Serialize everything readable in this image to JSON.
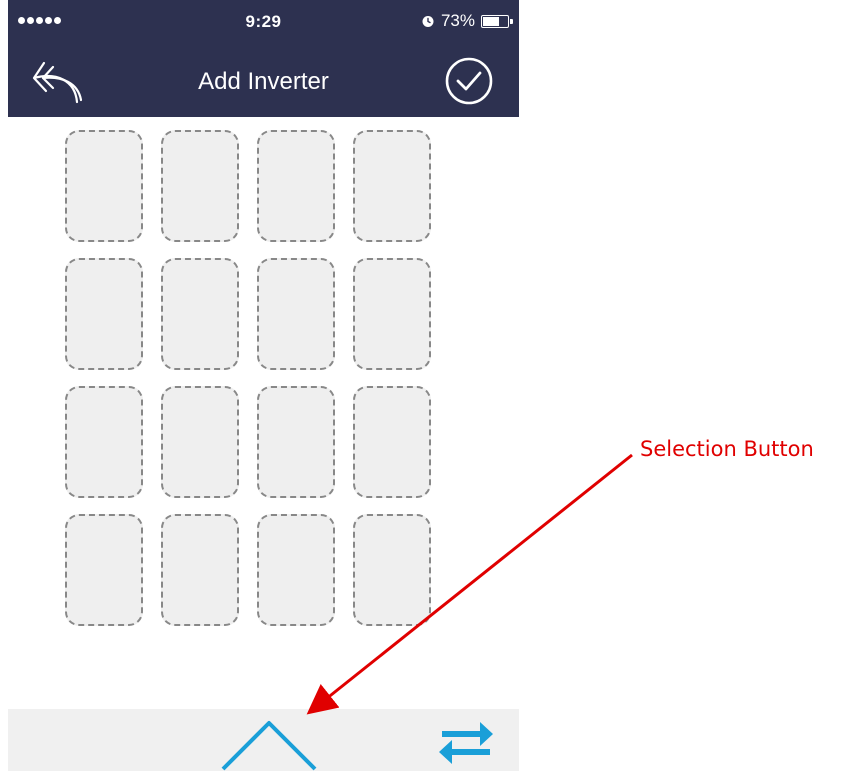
{
  "status_bar": {
    "time": "9:29",
    "battery_percent_label": "73%",
    "battery_level": 0.73,
    "signal_dots": 5,
    "icons": [
      "signal-dots-icon",
      "alarm-clock-icon",
      "battery-icon"
    ]
  },
  "nav": {
    "title": "Add Inverter",
    "back_icon": "back-arrow-icon",
    "confirm_icon": "check-circle-icon"
  },
  "grid": {
    "rows": 4,
    "columns": 4,
    "slot_count": 16
  },
  "bottom_bar": {
    "selection_icon": "triangle-up-icon",
    "swap_icon": "swap-arrows-icon"
  },
  "annotation": {
    "label": "Selection Button"
  },
  "colors": {
    "nav_background": "#2d3150",
    "accent_blue": "#1a9fd8",
    "annotation_red": "#e00000",
    "slot_border": "#888888",
    "slot_fill": "#efefef",
    "bottom_bar": "#f0f0f0"
  }
}
